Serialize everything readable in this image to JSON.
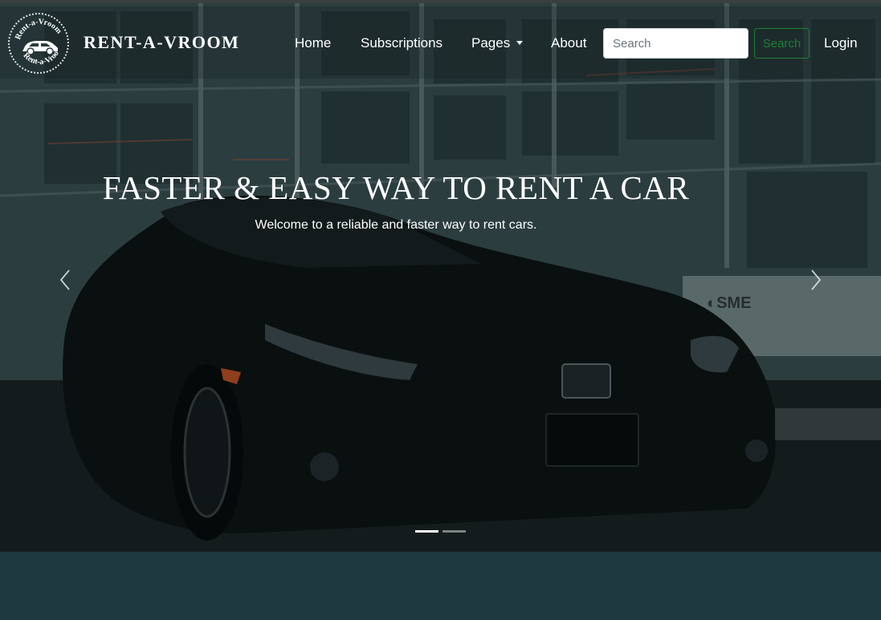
{
  "brand": {
    "name": "RENT-A-VROOM",
    "logo_text": "Rent-a-Vroom"
  },
  "nav": {
    "items": [
      {
        "label": "Home"
      },
      {
        "label": "Subscriptions"
      },
      {
        "label": "Pages"
      },
      {
        "label": "About"
      }
    ],
    "search_placeholder": "Search",
    "search_button": "Search",
    "login": "Login"
  },
  "hero": {
    "title": "FASTER & EASY WAY TO RENT A CAR",
    "subtitle": "Welcome to a reliable and faster way to rent cars.",
    "slides_total": 2,
    "active_slide": 1
  },
  "colors": {
    "page_bg": "#1e3a3e",
    "search_accent": "#1e7e34",
    "text": "#ffffff"
  },
  "icons": {
    "prev": "chevron-left-icon",
    "next": "chevron-right-icon",
    "dropdown": "caret-down-icon",
    "logo_car": "car-icon"
  }
}
